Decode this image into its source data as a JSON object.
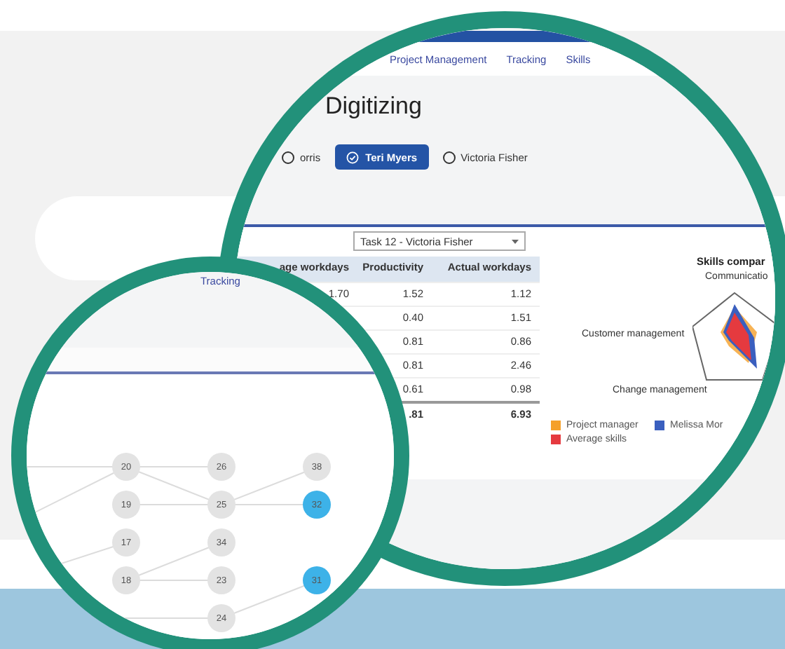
{
  "big_lens": {
    "nav_tabs": [
      {
        "label": "Project Management"
      },
      {
        "label": "Tracking"
      },
      {
        "label": "Skills"
      }
    ],
    "title": "Digitizing",
    "people": [
      {
        "name": "orris",
        "selected": false
      },
      {
        "name": "Teri Myers",
        "selected": true
      },
      {
        "name": "Victoria Fisher",
        "selected": false
      }
    ],
    "task_select": {
      "value": "Task 12 - Victoria Fisher"
    },
    "table": {
      "columns": [
        "age workdays",
        "Productivity",
        "Actual workdays"
      ],
      "rows": [
        {
          "age_workdays": "1.70",
          "productivity": "1.52",
          "actual_workdays": "1.12"
        },
        {
          "productivity": "0.40",
          "actual_workdays": "1.51"
        },
        {
          "productivity": "0.81",
          "actual_workdays": "0.86"
        },
        {
          "productivity": "0.81",
          "actual_workdays": "2.46"
        },
        {
          "productivity": "0.61",
          "actual_workdays": "0.98"
        }
      ],
      "total": {
        "productivity": ".81",
        "actual_workdays": "6.93"
      }
    },
    "skills_chart": {
      "title": "Skills compar",
      "axis_top": "Communicatio",
      "axis_left": "Customer management",
      "axis_bottom": "Change management",
      "legend": [
        {
          "label": "Project manager",
          "color": "#f5a02a"
        },
        {
          "label": "Melissa Mor",
          "color": "#3a5fbf"
        },
        {
          "label": "Average skills",
          "color": "#e53a3f"
        }
      ]
    }
  },
  "small_lens": {
    "nav_tabs": [
      {
        "label": "Tracking"
      }
    ],
    "node_rows": [
      [
        {
          "label": "20",
          "color": "#e3e3e3"
        },
        {
          "label": "26",
          "color": "#e3e3e3"
        },
        {
          "label": "38",
          "color": "#e3e3e3"
        }
      ],
      [
        {
          "label": "19",
          "color": "#e3e3e3"
        },
        {
          "label": "25",
          "color": "#e3e3e3"
        },
        {
          "label": "32",
          "color": "#3db2e8"
        }
      ],
      [
        {
          "label": "17",
          "color": "#e3e3e3"
        },
        {
          "label": "34",
          "color": "#e3e3e3"
        },
        null
      ],
      [
        {
          "label": "18",
          "color": "#e3e3e3"
        },
        {
          "label": "23",
          "color": "#e3e3e3"
        },
        {
          "label": "31",
          "color": "#3db2e8"
        }
      ],
      [
        null,
        {
          "label": "24",
          "color": "#e3e3e3"
        },
        null
      ]
    ]
  }
}
